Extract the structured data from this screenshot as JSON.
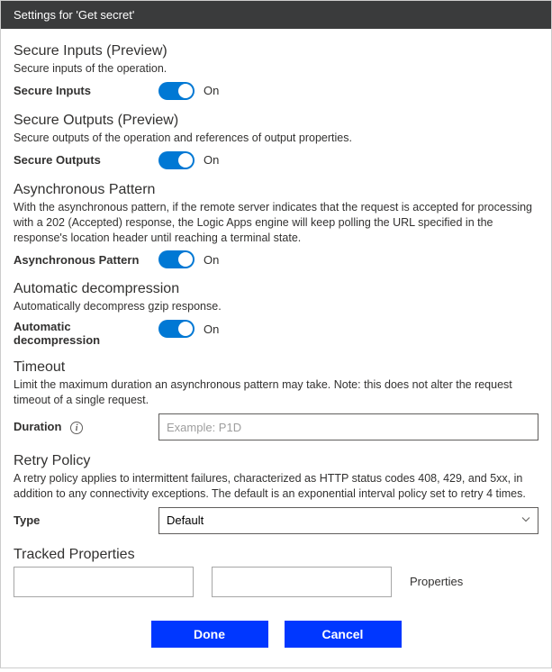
{
  "title": "Settings for 'Get secret'",
  "sections": {
    "secureInputs": {
      "title": "Secure Inputs (Preview)",
      "desc": "Secure inputs of the operation.",
      "label": "Secure Inputs",
      "state": "On"
    },
    "secureOutputs": {
      "title": "Secure Outputs (Preview)",
      "desc": "Secure outputs of the operation and references of output properties.",
      "label": "Secure Outputs",
      "state": "On"
    },
    "asyncPattern": {
      "title": "Asynchronous Pattern",
      "desc": "With the asynchronous pattern, if the remote server indicates that the request is accepted for processing with a 202 (Accepted) response, the Logic Apps engine will keep polling the URL specified in the response's location header until reaching a terminal state.",
      "label": "Asynchronous Pattern",
      "state": "On"
    },
    "autoDecompress": {
      "title": "Automatic decompression",
      "desc": "Automatically decompress gzip response.",
      "label": "Automatic decompression",
      "state": "On"
    },
    "timeout": {
      "title": "Timeout",
      "desc": "Limit the maximum duration an asynchronous pattern may take. Note: this does not alter the request timeout of a single request.",
      "label": "Duration",
      "placeholder": "Example: P1D"
    },
    "retry": {
      "title": "Retry Policy",
      "desc": "A retry policy applies to intermittent failures, characterized as HTTP status codes 408, 429, and 5xx, in addition to any connectivity exceptions. The default is an exponential interval policy set to retry 4 times.",
      "label": "Type",
      "value": "Default"
    },
    "tracked": {
      "title": "Tracked Properties",
      "propLabel": "Properties"
    }
  },
  "buttons": {
    "done": "Done",
    "cancel": "Cancel"
  }
}
